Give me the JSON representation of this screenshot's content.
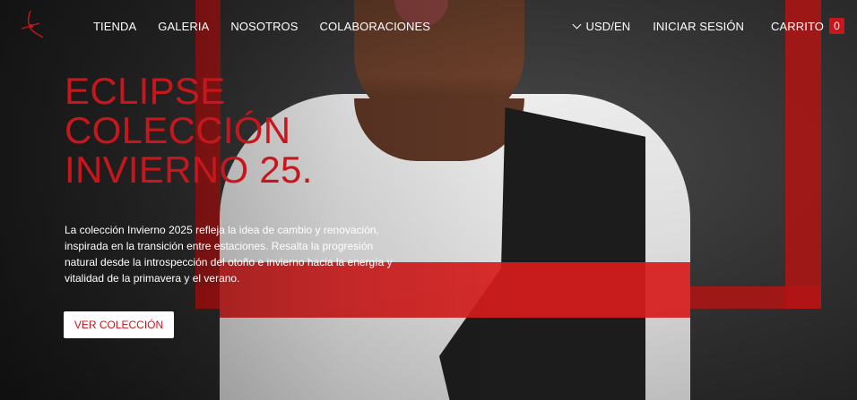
{
  "nav": {
    "left": [
      "TIENDA",
      "GALERIA",
      "NOSOTROS",
      "COLABORACIONES"
    ],
    "currency": "USD/EN",
    "login": "INICIAR SESIÓN",
    "cart_label": "CARRITO",
    "cart_count": "0"
  },
  "hero": {
    "title_lines": [
      "ECLIPSE",
      "COLECCIÓN",
      "INVIERNO 25."
    ],
    "description": "La colección Invierno 2025 refleja la idea de cambio y renovación, inspirada en la transición entre estaciones. Resalta la progresión natural desde la introspección del otoño e invierno hacia la energía y vitalidad de la primavera y el verano.",
    "cta": "VER COLECCIÓN"
  },
  "colors": {
    "brand_red": "#c8161d",
    "text_light": "#ffffff"
  },
  "icons": {
    "logo": "brand-logo-icon",
    "currency": "chevron-down-icon"
  }
}
